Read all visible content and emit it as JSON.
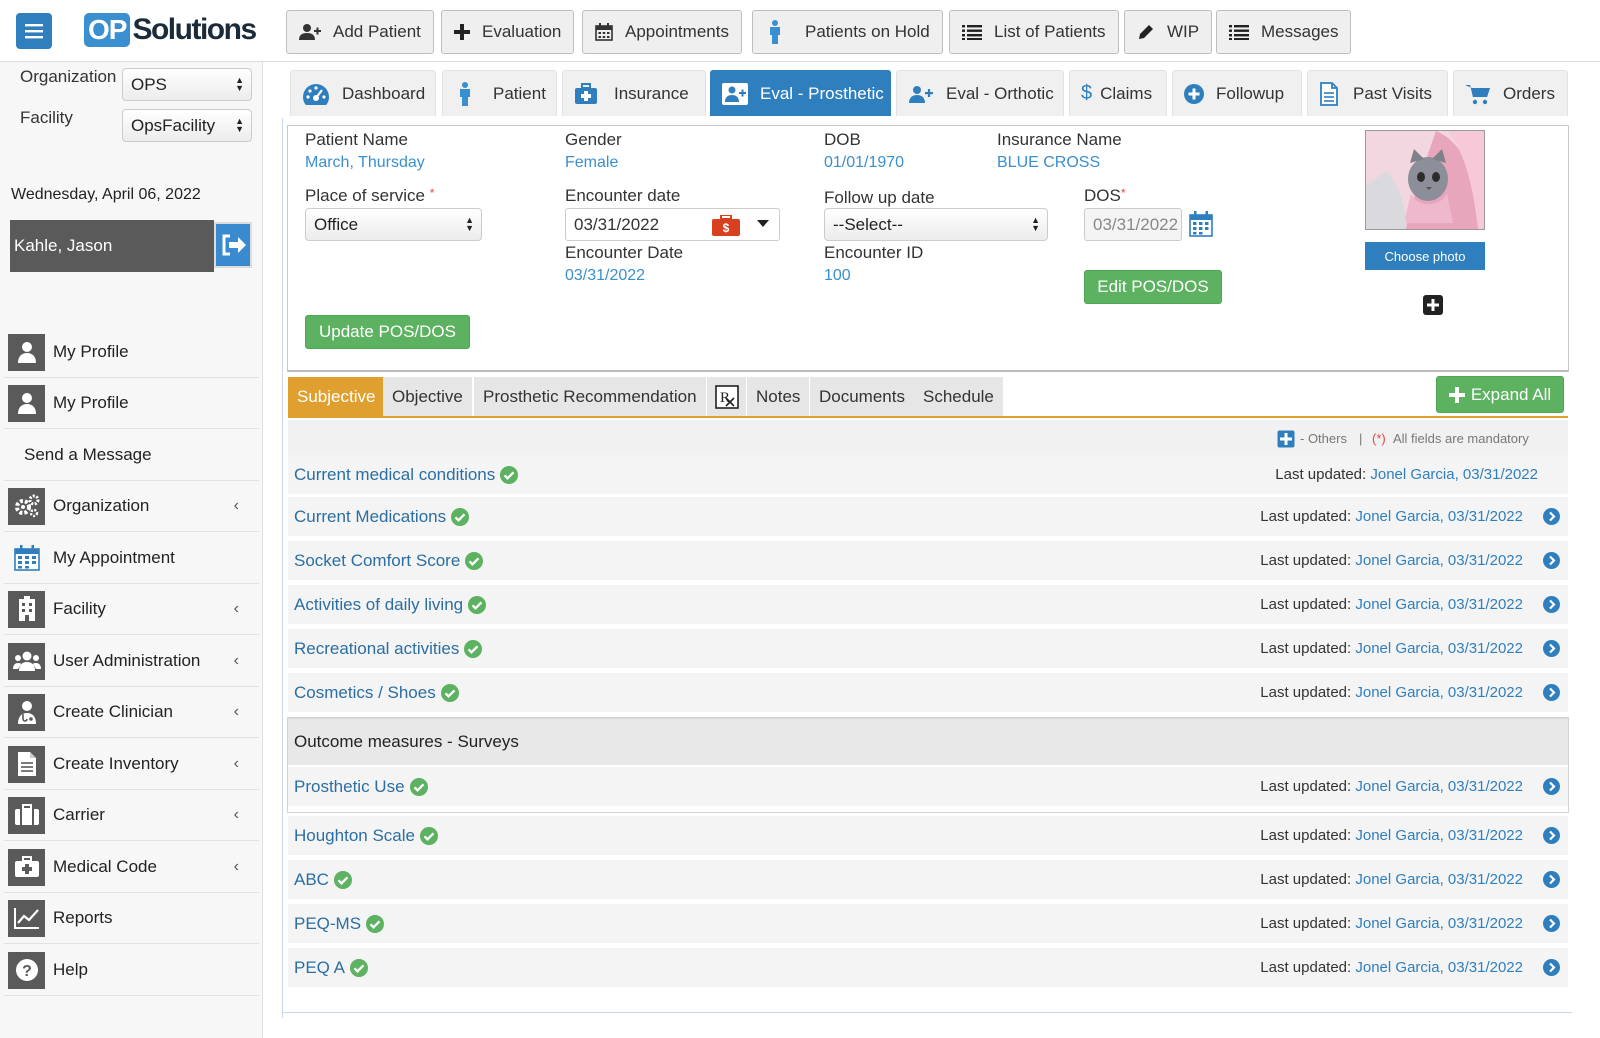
{
  "app": {
    "logo_op": "OP",
    "logo_sol": "Solutions"
  },
  "topnav": [
    {
      "label": "Add Patient",
      "icon": "add-user-icon"
    },
    {
      "label": "Evaluation",
      "icon": "plus-icon"
    },
    {
      "label": "Appointments",
      "icon": "calendar-icon"
    },
    {
      "label": "Patients on Hold",
      "icon": "person-icon"
    },
    {
      "label": "List of Patients",
      "icon": "list-icon"
    },
    {
      "label": "WIP",
      "icon": "pencil-icon"
    },
    {
      "label": "Messages",
      "icon": "list-icon"
    }
  ],
  "sidebar": {
    "org_label": "Organization",
    "org_value": "OPS",
    "facility_label": "Facility",
    "facility_value": "OpsFacility",
    "date": "Wednesday, April 06, 2022",
    "user": "Kahle, Jason",
    "items": [
      {
        "label": "My Profile",
        "icon": "user-icon",
        "chevron": false
      },
      {
        "label": "My Profile",
        "icon": "user-icon",
        "chevron": false
      },
      {
        "label": "Send a Message",
        "icon": "",
        "chevron": false
      },
      {
        "label": "Organization",
        "icon": "gears-icon",
        "chevron": true
      },
      {
        "label": "My Appointment",
        "icon": "calendar-icon",
        "chevron": false
      },
      {
        "label": "Facility",
        "icon": "building-icon",
        "chevron": true
      },
      {
        "label": "User Administration",
        "icon": "users-icon",
        "chevron": true
      },
      {
        "label": "Create Clinician",
        "icon": "doctor-icon",
        "chevron": true
      },
      {
        "label": "Create Inventory",
        "icon": "file-icon",
        "chevron": true
      },
      {
        "label": "Carrier",
        "icon": "briefcase-icon",
        "chevron": true
      },
      {
        "label": "Medical Code",
        "icon": "medkit-icon",
        "chevron": true
      },
      {
        "label": "Reports",
        "icon": "chart-icon",
        "chevron": false
      },
      {
        "label": "Help",
        "icon": "help-icon",
        "chevron": false
      }
    ],
    "chevron": "‹"
  },
  "tabs": [
    {
      "label": "Dashboard",
      "icon": "dashboard-icon"
    },
    {
      "label": "Patient",
      "icon": "person-icon"
    },
    {
      "label": "Insurance",
      "icon": "medkit-icon"
    },
    {
      "label": "Eval - Prosthetic",
      "icon": "add-user-icon"
    },
    {
      "label": "Eval - Orthotic",
      "icon": "add-user-icon"
    },
    {
      "label": "Claims",
      "icon": "dollar-icon"
    },
    {
      "label": "Followup",
      "icon": "plus-circle-icon"
    },
    {
      "label": "Past Visits",
      "icon": "file-icon"
    },
    {
      "label": "Orders",
      "icon": "cart-icon"
    }
  ],
  "patient": {
    "name_label": "Patient Name",
    "name": "March, Thursday",
    "gender_label": "Gender",
    "gender": "Female",
    "dob_label": "DOB",
    "dob": "01/01/1970",
    "ins_label": "Insurance Name",
    "ins": "BLUE CROSS",
    "pos_label": "Place of service",
    "pos": "Office",
    "enc_date_label": "Encounter date",
    "enc_date": "03/31/2022",
    "enc_date2_label": "Encounter Date",
    "enc_date2": "03/31/2022",
    "follow_label": "Follow up date",
    "follow": "--Select--",
    "enc_id_label": "Encounter ID",
    "enc_id": "100",
    "dos_label": "DOS",
    "dos": "03/31/2022",
    "req": "*",
    "edit_btn": "Edit POS/DOS",
    "update_btn": "Update POS/DOS",
    "photo_btn": "Choose photo"
  },
  "subtabs": [
    "Subjective",
    "Objective",
    "Prosthetic Recommendation",
    "Notes",
    "Documents",
    "Schedule"
  ],
  "expand_all": "Expand All",
  "legend": {
    "others": "- Others",
    "sep": "|",
    "mand_mark": "(*)",
    "mandatory": "All fields are mandatory"
  },
  "last_updated_label": "Last updated:",
  "rows": [
    {
      "title": "Current medical conditions",
      "who": "Jonel Garcia, 03/31/2022",
      "arrow": false
    },
    {
      "title": "Current Medications",
      "who": "Jonel Garcia, 03/31/2022",
      "arrow": true
    },
    {
      "title": "Socket Comfort Score",
      "who": "Jonel Garcia, 03/31/2022",
      "arrow": true
    },
    {
      "title": "Activities of daily living",
      "who": "Jonel Garcia, 03/31/2022",
      "arrow": true
    },
    {
      "title": "Recreational activities",
      "who": "Jonel Garcia, 03/31/2022",
      "arrow": true
    },
    {
      "title": "Cosmetics / Shoes",
      "who": "Jonel Garcia, 03/31/2022",
      "arrow": true
    }
  ],
  "section": {
    "title": "Outcome measures - Surveys"
  },
  "section_rows": [
    {
      "title": "Prosthetic Use",
      "who": "Jonel Garcia, 03/31/2022"
    }
  ],
  "rows2": [
    {
      "title": "Houghton Scale",
      "who": "Jonel Garcia, 03/31/2022"
    },
    {
      "title": "ABC",
      "who": "Jonel Garcia, 03/31/2022"
    },
    {
      "title": "PEQ-MS",
      "who": "Jonel Garcia, 03/31/2022"
    },
    {
      "title": "PEQ A",
      "who": "Jonel Garcia, 03/31/2022"
    }
  ],
  "colors": {
    "primary": "#2f7fbf",
    "green": "#5cb260",
    "orange": "#e0a030",
    "link": "#3a8fd0"
  }
}
